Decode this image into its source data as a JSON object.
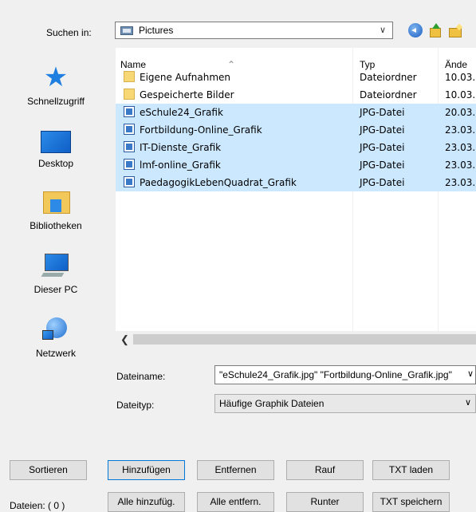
{
  "lookin": {
    "label": "Suchen in:",
    "value": "Pictures"
  },
  "nav": [
    {
      "label": "Schnellzugriff",
      "icon": "quick-access-star-icon"
    },
    {
      "label": "Desktop",
      "icon": "desktop-icon"
    },
    {
      "label": "Bibliotheken",
      "icon": "libraries-icon"
    },
    {
      "label": "Dieser PC",
      "icon": "this-pc-icon"
    },
    {
      "label": "Netzwerk",
      "icon": "network-icon"
    }
  ],
  "columns": {
    "name": "Name",
    "type": "Typ",
    "date": "Ände"
  },
  "files": [
    {
      "name": "Eigene Aufnahmen",
      "type": "Dateiordner",
      "date": "10.03.",
      "kind": "folder",
      "selected": false
    },
    {
      "name": "Gespeicherte Bilder",
      "type": "Dateiordner",
      "date": "10.03.",
      "kind": "folder",
      "selected": false
    },
    {
      "name": "eSchule24_Grafik",
      "type": "JPG-Datei",
      "date": "20.03.",
      "kind": "jpg",
      "selected": true
    },
    {
      "name": "Fortbildung-Online_Grafik",
      "type": "JPG-Datei",
      "date": "23.03.",
      "kind": "jpg",
      "selected": true
    },
    {
      "name": "IT-Dienste_Grafik",
      "type": "JPG-Datei",
      "date": "23.03.",
      "kind": "jpg",
      "selected": true
    },
    {
      "name": "lmf-online_Grafik",
      "type": "JPG-Datei",
      "date": "23.03.",
      "kind": "jpg",
      "selected": true
    },
    {
      "name": "PaedagogikLebenQuadrat_Grafik",
      "type": "JPG-Datei",
      "date": "23.03.",
      "kind": "jpg",
      "selected": true
    }
  ],
  "filename": {
    "label": "Dateiname:",
    "value": "\"eSchule24_Grafik.jpg\" \"Fortbildung-Online_Grafik.jpg\""
  },
  "filetype": {
    "label": "Dateityp:",
    "value": "Häufige Graphik Dateien"
  },
  "buttons": {
    "sort": "Sortieren",
    "add": "Hinzufügen",
    "remove": "Entfernen",
    "up": "Rauf",
    "load_txt": "TXT laden",
    "add_all": "Alle hinzufüg.",
    "remove_all": "Alle entfern.",
    "down": "Runter",
    "save_txt": "TXT speichern"
  },
  "status": {
    "label": "Dateien:",
    "count": "( 0 )"
  },
  "colors": {
    "selection": "#cce8ff",
    "focus_border": "#0078d7"
  }
}
